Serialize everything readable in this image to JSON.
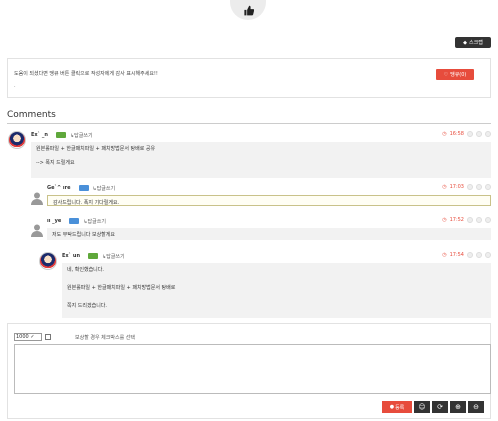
{
  "header": {
    "thumb_icon": "thumbs-up-icon"
  },
  "scrap": {
    "label": "스크랩",
    "icon": "bookmark-icon"
  },
  "notice": {
    "text": "도움이 되셨다면 맹큐 버튼 클릭으로 작성자에게 감사 표시해주세요!!",
    "dot": ".",
    "like_label": "땡큐(0)",
    "like_icon": "heart-icon"
  },
  "comments": {
    "title": "Comments",
    "items": [
      {
        "name": "Ex`  _n",
        "level": "green",
        "reply": "↳답글쓰기",
        "time": "16:58",
        "lines": [
          "원본롤파일 + 한글패치파일 + 패치방법문서 탕배로 공유",
          "",
          "--> 폭지 드릴게요"
        ]
      },
      {
        "name": "Ge`^  ıre",
        "level": "blue",
        "reply": "↳답글쓰기",
        "time": "17:03",
        "lines": [
          "감사드립니다. 폭지 기다릴게요."
        ]
      },
      {
        "name": "ıı  _ye",
        "level": "blue",
        "reply": "↳답글쓰기",
        "time": "17:52",
        "lines": [
          "저도 부탁드립니다 보상할게요"
        ]
      },
      {
        "name": "Ex`  un",
        "level": "green",
        "reply": "↳답글쓰기",
        "time": "17:54",
        "lines": [
          "네, 확인했습니다.",
          "",
          "원본롤파일 + 한글패치파일 + 패치방법문서 탕배로",
          "",
          "쪽지 드리겠습니다."
        ]
      }
    ]
  },
  "editor": {
    "select_value": "1000 ✓",
    "secret_label": "보상할 경우 체크박스를 선택",
    "submit_label": "등록",
    "submit_icon": "comment-icon",
    "tools": [
      "emoji-icon",
      "refresh-icon",
      "plus-icon",
      "minus-icon"
    ]
  },
  "colors": {
    "accent_red": "#e74c3c",
    "dark": "#333333"
  }
}
